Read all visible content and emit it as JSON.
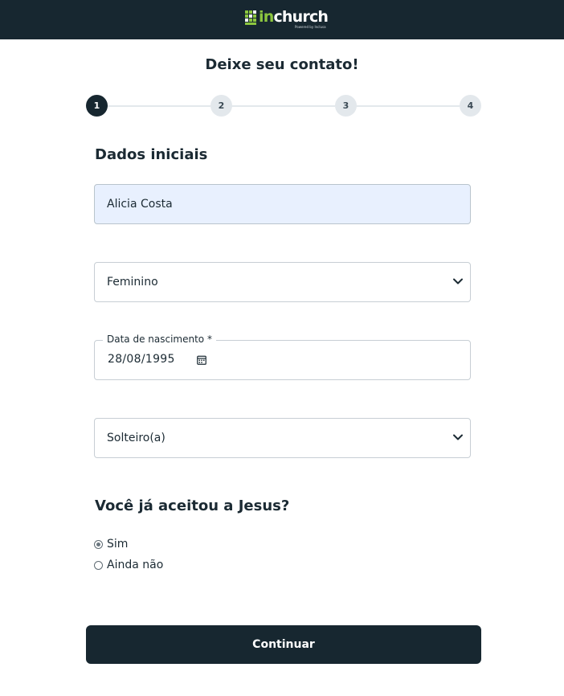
{
  "header": {
    "logo_in": "in",
    "logo_church": "church",
    "logo_sub": "Powered by Inclusa"
  },
  "page": {
    "title": "Deixe seu contato!"
  },
  "stepper": {
    "current": 1,
    "steps": [
      "1",
      "2",
      "3",
      "4"
    ]
  },
  "form": {
    "section_title": "Dados iniciais",
    "name_value": "Alicia Costa",
    "gender_value": "Feminino",
    "birthdate_label": "Data de nascimento *",
    "birthdate_value": "28/08/1995",
    "marital_value": "Solteiro(a)",
    "question": "Você já aceitou a Jesus?",
    "options": [
      {
        "label": "Sim",
        "checked": true
      },
      {
        "label": "Ainda não",
        "checked": false
      }
    ],
    "submit_label": "Continuar"
  },
  "colors": {
    "dark": "#172730",
    "accent": "#8cc63f",
    "autofill": "#e8f0fe",
    "step_inactive": "#e3e8ec"
  },
  "icons": [
    "logo-grid-icon",
    "chevron-down-icon",
    "calendar-icon"
  ]
}
